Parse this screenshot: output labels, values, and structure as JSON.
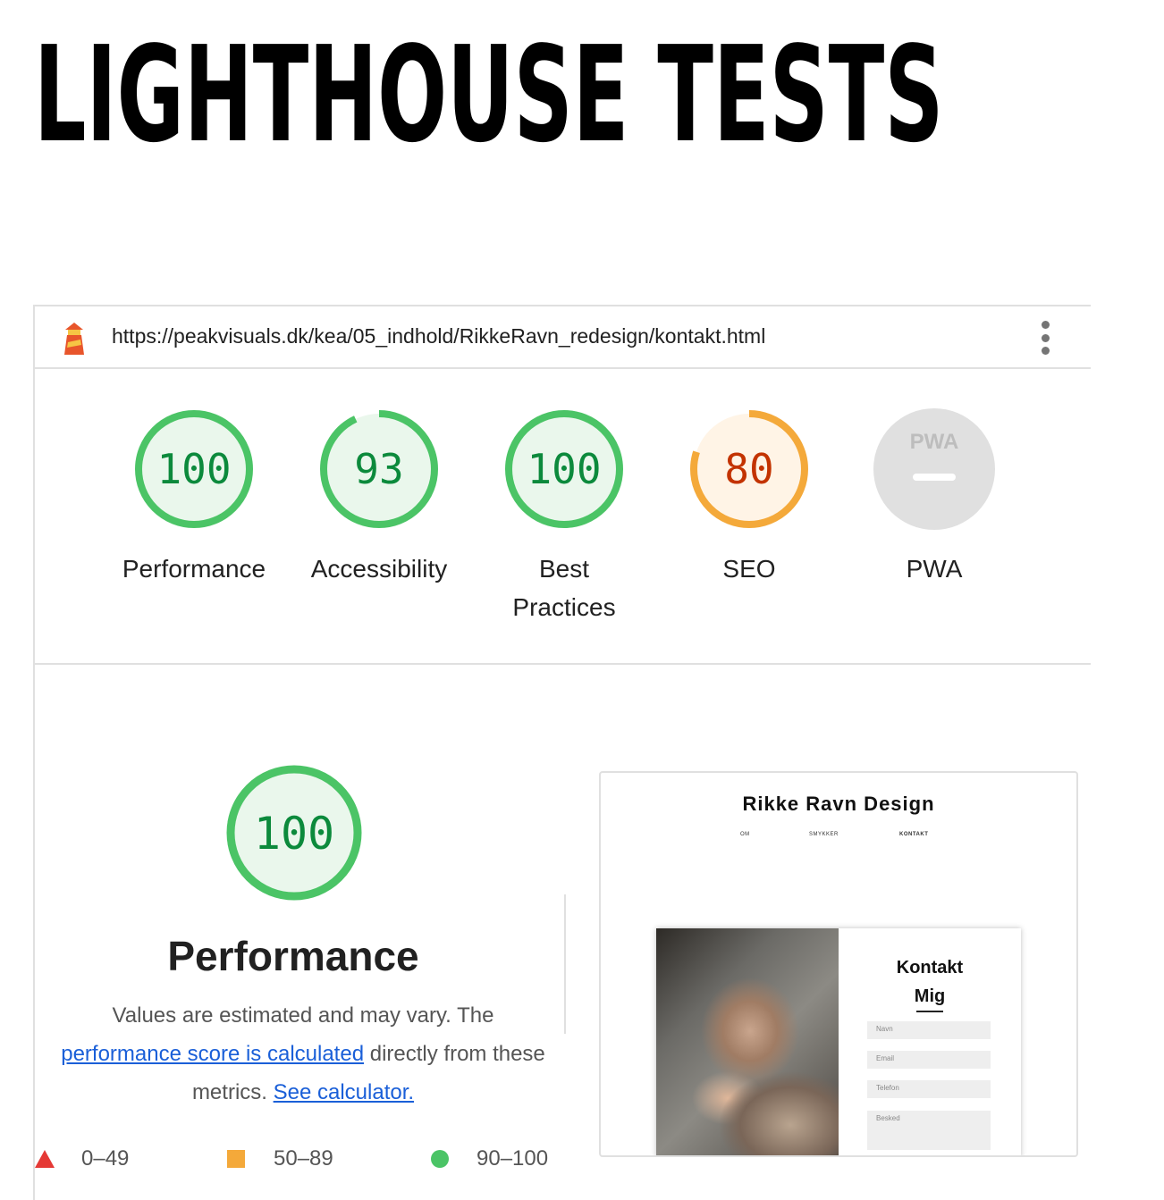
{
  "page": {
    "heading": "LIGHTHOUSE TESTS"
  },
  "report": {
    "url": "https://peakvisuals.dk/kea/05_indhold/RikkeRavn_redesign/kontakt.html",
    "icons": {
      "logo": "lighthouse-icon",
      "menu": "kebab-menu-icon"
    },
    "gauges": [
      {
        "score": "100",
        "label": "Performance",
        "value": 100,
        "color": "#0c8a3c",
        "ring": "#4bc466",
        "fill": "#eaf7ec"
      },
      {
        "score": "93",
        "label": "Accessibility",
        "value": 93,
        "color": "#0c8a3c",
        "ring": "#4bc466",
        "fill": "#eaf7ec"
      },
      {
        "score": "100",
        "label": "Best Practices",
        "value": 100,
        "color": "#0c8a3c",
        "ring": "#4bc466",
        "fill": "#eaf7ec"
      },
      {
        "score": "80",
        "label": "SEO",
        "value": 80,
        "color": "#c33300",
        "ring": "#f4a93a",
        "fill": "#fff4e6"
      },
      {
        "score": "PWA",
        "label": "PWA",
        "value": null,
        "color": "#bdbdbd",
        "ring": "#e0e0e0",
        "fill": "#e0e0e0"
      }
    ],
    "performance": {
      "score": "100",
      "title": "Performance",
      "desc_part1": "Values are estimated and may vary. The ",
      "link1": "performance score is calculated",
      "desc_part2": " directly from these metrics. ",
      "link2": "See calculator."
    },
    "legend": [
      {
        "shape": "triangle",
        "label": "0–49",
        "color": "#e53935"
      },
      {
        "shape": "square",
        "label": "50–89",
        "color": "#f4a93a"
      },
      {
        "shape": "circle",
        "label": "90–100",
        "color": "#4bc466"
      }
    ],
    "screenshot": {
      "site_title": "Rikke Ravn Design",
      "nav": [
        "OM",
        "SMYKKER",
        "KONTAKT"
      ],
      "form_title_line1": "Kontakt",
      "form_title_line2": "Mig",
      "fields": [
        "Navn",
        "Email",
        "Telefon",
        "Besked"
      ]
    }
  }
}
